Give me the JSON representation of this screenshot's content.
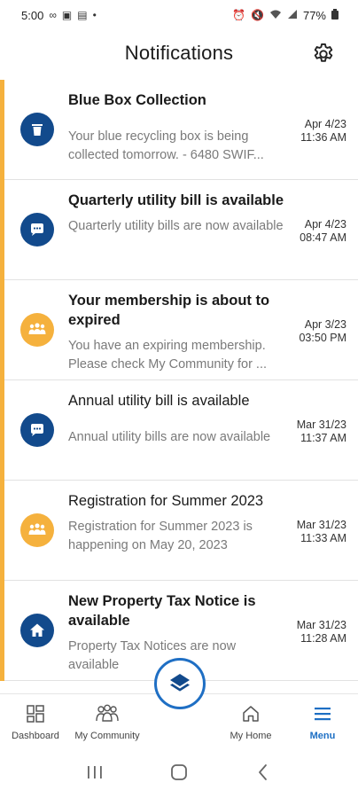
{
  "status_bar": {
    "time": "5:00",
    "battery": "77%",
    "left_icons": [
      "infinity-icon",
      "gallery-icon",
      "image-icon",
      "dot-icon"
    ],
    "right_icons": [
      "alarm-icon",
      "mute-icon",
      "wifi-icon",
      "signal-icon",
      "battery-icon"
    ]
  },
  "header": {
    "title": "Notifications",
    "settings_icon": "gear-icon"
  },
  "notifications": [
    {
      "title": "Blue Box Collection",
      "body": "Your blue recycling box is being collected tomorrow. - 6480 SWIF...",
      "date": "Apr 4/23",
      "time": "11:36 AM",
      "icon": "trash-bin-icon",
      "color": "#124a8c",
      "unread": true
    },
    {
      "title": "Quarterly utility bill is available",
      "body": "Quarterly utility bills are now available",
      "date": "Apr 4/23",
      "time": "08:47 AM",
      "icon": "chat-bubble-icon",
      "color": "#124a8c",
      "unread": true
    },
    {
      "title": "Your membership is about to expired",
      "body": "You have an expiring membership. Please check My Community for ...",
      "date": "Apr 3/23",
      "time": "03:50 PM",
      "icon": "community-icon",
      "color": "#f5b13d",
      "unread": true
    },
    {
      "title": "Annual utility bill is available",
      "body": "Annual utility bills are now available",
      "date": "Mar 31/23",
      "time": "11:37 AM",
      "icon": "chat-bubble-icon",
      "color": "#124a8c",
      "unread": true
    },
    {
      "title": "Registration for Summer 2023",
      "body": "Registration for Summer 2023 is happening on May 20, 2023",
      "date": "Mar 31/23",
      "time": "11:33 AM",
      "icon": "community-icon",
      "color": "#f5b13d",
      "unread": true
    },
    {
      "title": "New Property Tax Notice is available",
      "body": "Property Tax Notices are now available",
      "date": "Mar 31/23",
      "time": "11:28 AM",
      "icon": "home-icon",
      "color": "#124a8c",
      "unread": true
    }
  ],
  "bottom_nav": {
    "items": [
      {
        "label": "Dashboard",
        "icon": "dashboard-icon"
      },
      {
        "label": "My Community",
        "icon": "community-icon"
      },
      {
        "label": "",
        "icon": "layers-icon"
      },
      {
        "label": "My Home",
        "icon": "home-outline-icon"
      },
      {
        "label": "Menu",
        "icon": "hamburger-icon"
      }
    ],
    "active": "Menu"
  },
  "colors": {
    "accent_blue": "#124a8c",
    "accent_orange": "#f5b13d",
    "active_blue": "#1d6fc4"
  }
}
